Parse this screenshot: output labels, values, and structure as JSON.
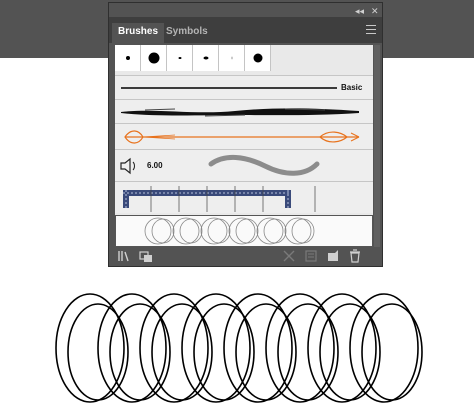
{
  "panel": {
    "tabs": [
      {
        "label": "Brushes",
        "active": true
      },
      {
        "label": "Symbols",
        "active": false
      }
    ],
    "window_controls": {
      "collapse_glyph": "◂◂",
      "close_glyph": "✕"
    },
    "menu_icon": "hamburger-menu-icon"
  },
  "brushes": {
    "calligraphic_dots": [
      {
        "name": "dot-1"
      },
      {
        "name": "dot-2"
      },
      {
        "name": "dot-3"
      },
      {
        "name": "dot-4"
      },
      {
        "name": "dot-5"
      },
      {
        "name": "dot-6"
      }
    ],
    "basic_label": "Basic",
    "bristle_size": "6.00"
  },
  "footer_icons": [
    "brush-libraries-icon",
    "libraries-panel-icon",
    "remove-brush-stroke-icon",
    "brush-options-icon",
    "new-brush-icon",
    "delete-brush-icon"
  ],
  "colors": {
    "panel_bg": "#535353",
    "tab_strip": "#3e3e3e",
    "list_bg": "#e9e9e9",
    "art_brush_orange": "#e8731e",
    "pattern_blue": "#3a4a7a"
  }
}
